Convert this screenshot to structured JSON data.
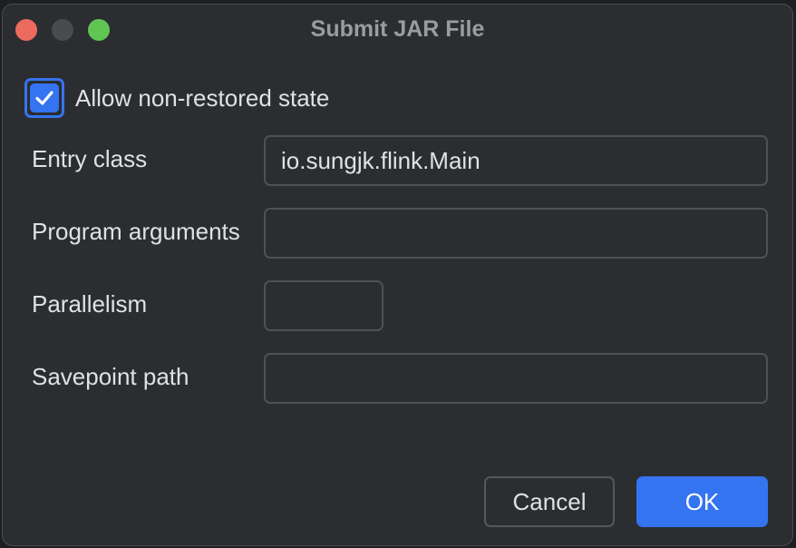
{
  "window": {
    "title": "Submit JAR File"
  },
  "allow_non_restored": {
    "label": "Allow non-restored state",
    "checked": true
  },
  "form": {
    "entry_class": {
      "label": "Entry class",
      "value": "io.sungjk.flink.Main"
    },
    "program_arguments": {
      "label": "Program arguments",
      "value": ""
    },
    "parallelism": {
      "label": "Parallelism",
      "value": ""
    },
    "savepoint_path": {
      "label": "Savepoint path",
      "value": ""
    }
  },
  "buttons": {
    "cancel": "Cancel",
    "ok": "OK"
  },
  "colors": {
    "accent": "#3574f0",
    "close": "#ed6a5e",
    "maximize": "#61c554"
  },
  "icons": {
    "check": "checkmark-icon"
  }
}
